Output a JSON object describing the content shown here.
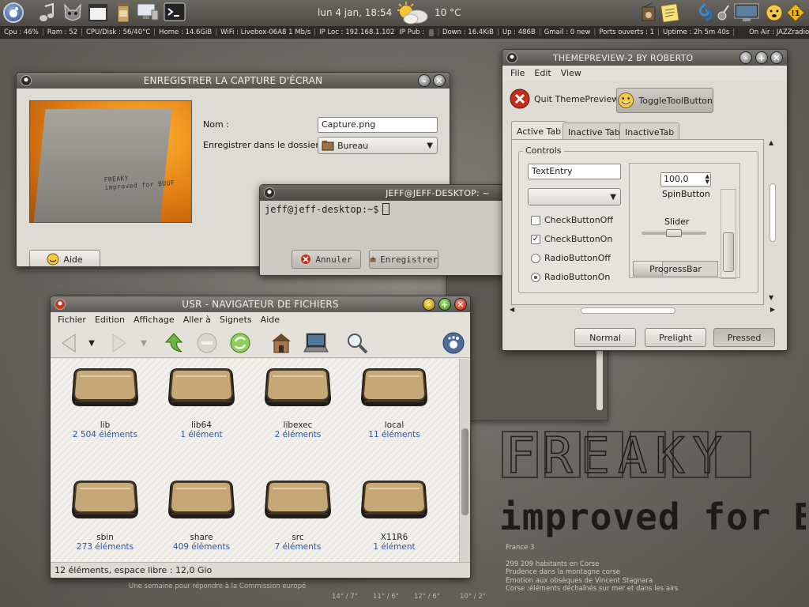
{
  "top_panel": {
    "clock": "lun   4 jan, 18:54",
    "temperature": "10 °C"
  },
  "stats": {
    "items": [
      "Cpu : 46%",
      "Ram : 52",
      "CPU/Disk : 56/40°C",
      "Home : 14.6GiB",
      "WiFi : Livebox-06A8 1 Mb/s",
      "IP Loc : 192.168.1.102",
      "IP Pub :",
      "Down : 16.4KiB",
      "Up : 486B",
      "Gmail : 0 new",
      "Ports ouverts : 1",
      "Uptime : 2h 5m 40s",
      "On Air : JAZZradio - JAZZradio -"
    ]
  },
  "save_window": {
    "title": "ENREGISTRER LA CAPTURE D'ÉCRAN",
    "name_label": "Nom :",
    "name_value": "Capture.png",
    "folder_label": "Enregistrer dans le dossier :",
    "folder_value": "Bureau",
    "help_button": "Aide",
    "cancel_button": "Annuler",
    "save_button": "Enregistrer",
    "thumb_text": "FREAKY\nimproved for BUUF"
  },
  "terminal": {
    "title": "JEFF@JEFF-DESKTOP: ~",
    "prompt": "jeff@jeff-desktop:~$"
  },
  "theme_preview": {
    "title": "THEMEPREVIEW-2 BY ROBERTO",
    "menu": [
      "File",
      "Edit",
      "View"
    ],
    "quit_button": "Quit ThemePreview!",
    "toggle_button": "ToggleToolButton",
    "tabs": [
      "Active Tab",
      "Inactive Tab",
      "InactiveTab"
    ],
    "controls_label": "Controls",
    "text_entry": "TextEntry",
    "check_off": "CheckButtonOff",
    "check_on": "CheckButtonOn",
    "radio_off": "RadioButtonOff",
    "radio_on": "RadioButtonOn",
    "spin_value": "100,0",
    "spin_label": "SpinButton",
    "slider_label": "Slider",
    "slider_value": 0.5,
    "progress_label": "ProgressBar",
    "progress_value": 0.35,
    "buttons": [
      "Normal",
      "Prelight",
      "Pressed"
    ]
  },
  "file_manager": {
    "title": "USR - NAVIGATEUR DE FICHIERS",
    "menu": [
      "Fichier",
      "Edition",
      "Affichage",
      "Aller à",
      "Signets",
      "Aide"
    ],
    "folders": [
      {
        "name": "lib",
        "count": "2 504 éléments"
      },
      {
        "name": "lib64",
        "count": "1 élément"
      },
      {
        "name": "libexec",
        "count": "2 éléments"
      },
      {
        "name": "local",
        "count": "11 éléments"
      },
      {
        "name": "sbin",
        "count": "273 éléments"
      },
      {
        "name": "share",
        "count": "409 éléments"
      },
      {
        "name": "src",
        "count": "7 éléments"
      },
      {
        "name": "X11R6",
        "count": "1 élément"
      }
    ],
    "status": "12 éléments, espace libre : 12,0 Gio"
  },
  "desktop": {
    "logo_text_1": "FREAKY",
    "logo_text_2": "improved for BUUF",
    "news_header": "France 3",
    "news": [
      "299 209 habitants en Corse",
      "Prudence dans la montagne corse",
      "Emotion aux obsèques de Vincent Stagnara",
      "Corse :éléments déchaînés sur mer et dans les airs"
    ],
    "bottom_news": "Une semaine pour répondre à la Commission europé",
    "temps": [
      "14° / 7°",
      "11° / 6°",
      "12° / 6°",
      "10° / 2°"
    ]
  }
}
